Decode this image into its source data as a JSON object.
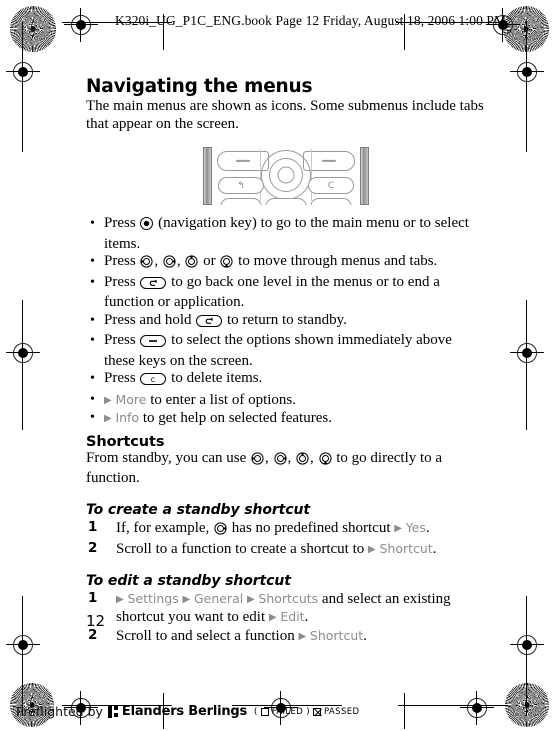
{
  "print_header": "K320i_UG_P1C_ENG.book  Page 12  Friday, August 18, 2006  1:00 PM",
  "page_number": "12",
  "section": {
    "title": "Navigating the menus",
    "intro": "The main menus are shown as icons. Some submenus include tabs that appear on the screen."
  },
  "keypad_image": {
    "caption": "",
    "back_key_label": "↰",
    "clear_key_label": "C"
  },
  "bullets": [
    {
      "pre": "Press ",
      "icon": "nav-center-key-icon",
      "post": " (navigation key) to go to the main menu or to select items."
    },
    {
      "pre": "Press ",
      "icon": "nav-direction-keys-icon",
      "post": " to move through menus and tabs."
    },
    {
      "pre": "Press ",
      "icon": "back-key-icon",
      "post": " to go back one level in the menus or to end a function or application."
    },
    {
      "pre": "Press and hold ",
      "icon": "back-key-icon",
      "post": " to return to standby."
    },
    {
      "pre": "Press ",
      "icon": "selection-key-icon",
      "post": " to select the options shown immediately above these keys on the screen."
    },
    {
      "pre": "Press ",
      "icon": "clear-key-icon",
      "post": " to delete items."
    },
    {
      "pre": "",
      "icon": "menu-arrow-icon",
      "menuref": "More",
      "post": " to enter a list of options."
    },
    {
      "pre": "",
      "icon": "menu-arrow-icon",
      "menuref": "Info",
      "post": " to get help on selected features."
    }
  ],
  "shortcuts": {
    "title": "Shortcuts",
    "intro_pre": "From standby, you can use ",
    "intro_post": " to go directly to a function."
  },
  "create_shortcut": {
    "title": "To create a standby shortcut",
    "steps": [
      {
        "num": "1",
        "pre": "If, for example, ",
        "mid": " has no predefined shortcut ",
        "menuref": "Yes",
        "post": "."
      },
      {
        "num": "2",
        "pre": "Scroll to a function to create a shortcut to ",
        "menuref": "Shortcut",
        "post": "."
      }
    ]
  },
  "edit_shortcut": {
    "title": "To edit a standby shortcut",
    "steps": [
      {
        "num": "1",
        "menurefs": [
          "Settings",
          "General",
          "Shortcuts"
        ],
        "mid": " and select an existing shortcut you want to edit ",
        "menuref2": "Edit",
        "post": "."
      },
      {
        "num": "2",
        "pre": "Scroll to and select a function ",
        "menuref": "Shortcut",
        "post": "."
      }
    ]
  },
  "preflight": {
    "label": "Preflighted by",
    "brand": "Elanders Berlings",
    "open_paren": "(",
    "failed": "FAILED",
    "close_paren": ")",
    "passed": "PASSED"
  },
  "colors": {
    "menu_reference": "#8d8d8d",
    "text": "#000000",
    "key_outline": "#9a9a9a"
  }
}
